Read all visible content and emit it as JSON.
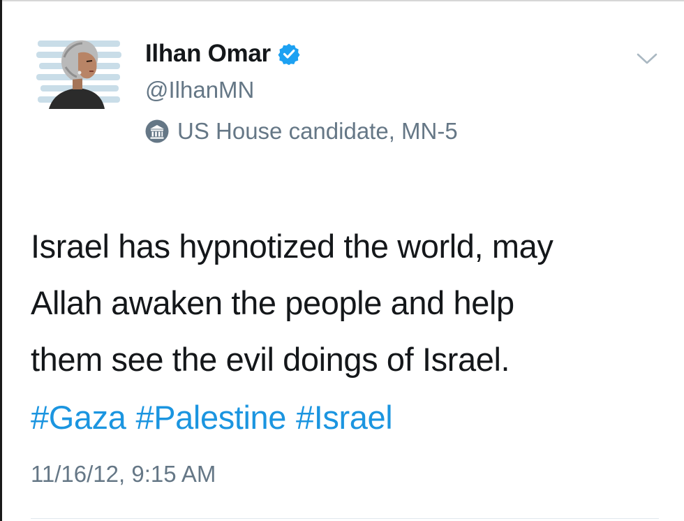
{
  "author": {
    "display_name": "Ilhan Omar",
    "handle": "@IlhanMN",
    "verified": true,
    "label": "US House candidate, MN-5",
    "label_icon": "government-building-icon"
  },
  "tweet": {
    "text_lines": [
      "Israel has hypnotized the world, may",
      "Allah awaken the people and help",
      "them see the evil doings of Israel."
    ],
    "hashtags": [
      "#Gaza",
      "#Palestine",
      "#Israel"
    ],
    "timestamp": "11/16/12, 9:15 AM"
  },
  "icons": {
    "verified": "verified-badge-icon",
    "menu": "chevron-down-icon"
  },
  "colors": {
    "text": "#14171a",
    "secondary": "#657786",
    "link": "#1b95e0",
    "verified": "#1da1f2"
  }
}
